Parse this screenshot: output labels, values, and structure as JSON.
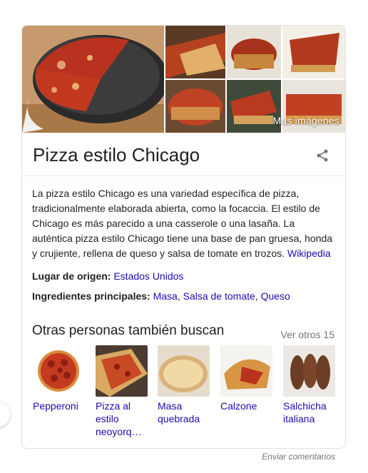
{
  "images": {
    "more_label": "Más imágenes"
  },
  "title": "Pizza estilo Chicago",
  "description": {
    "text": "La pizza estilo Chicago es una variedad específica de pizza, tradicionalmente elaborada abierta, como la focaccia. El estilo de Chicago es más parecido a una casserole o una lasaña. La auténtica pizza estilo Chicago tiene una base de pan gruesa, honda y crujiente, rellena de queso y salsa de tomate en trozos.",
    "source_link": "Wikipedia"
  },
  "facts": {
    "origin_label": "Lugar de origen:",
    "origin_value": "Estados Unidos",
    "ingredients_label": "Ingredientes principales:",
    "ingredients": [
      "Masa",
      "Salsa de tomate",
      "Queso"
    ],
    "separator": ","
  },
  "people_also_search": {
    "heading": "Otras personas también buscan",
    "see_more": "Ver otros 15",
    "items": [
      {
        "label": "Pepperoni"
      },
      {
        "label": "Pizza al estilo neoyorq…"
      },
      {
        "label": "Masa quebrada"
      },
      {
        "label": "Calzone"
      },
      {
        "label": "Salchicha italiana"
      }
    ]
  },
  "feedback": "Enviar comentarios",
  "icons": {
    "share": "share-icon",
    "side": "chevron-left-icon"
  },
  "colors": {
    "link": "#1a0dab",
    "text": "#202124",
    "muted": "#70757a",
    "border": "#dfe1e5"
  }
}
